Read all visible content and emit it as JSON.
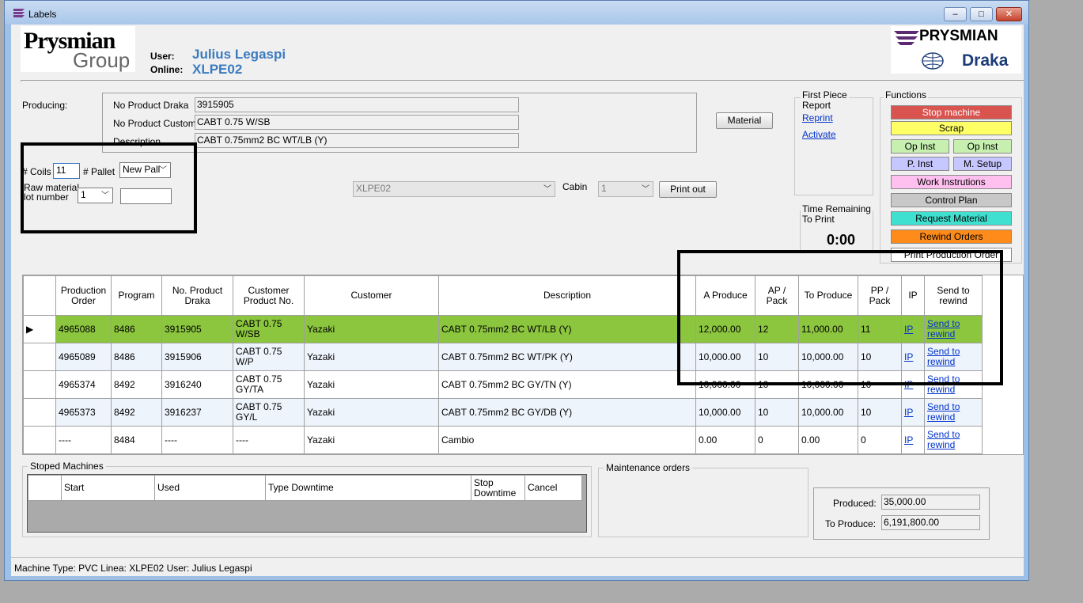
{
  "window": {
    "title": "Labels",
    "min": "–",
    "max": "□",
    "close": "✕"
  },
  "header": {
    "logo_line1": "Prysmian",
    "logo_line2": "Group",
    "user_label": "User:",
    "user_value": "Julius Legaspi",
    "online_label": "Online:",
    "online_value": "XLPE02",
    "brand_top": "PRYSMIAN",
    "brand_bottom": "Draka"
  },
  "producing": {
    "label": "Producing:",
    "no_product_draka_label": "No Product Draka",
    "no_product_draka": "3915905",
    "no_product_customer_label": "No Product Customer",
    "no_product_customer": "CABT 0.75 W/SB",
    "description_label": "Description",
    "description": "CABT 0.75mm2 BC WT/LB (Y)",
    "material_button": "Material"
  },
  "coils": {
    "coils_label": "# Coils",
    "coils_value": "11",
    "pallet_label": "# Pallet",
    "pallet_value": "New Pall",
    "raw_material_label1": "Raw material",
    "raw_material_label2": "lot number",
    "lot_value": "1",
    "lot_text": ""
  },
  "print": {
    "printer_value": "XLPE02",
    "cabin_label": "Cabin",
    "cabin_value": "1",
    "print_button": "Print out"
  },
  "first_piece": {
    "title1": "First Piece",
    "title2": "Report",
    "reprint": "Reprint",
    "activate": "Activate"
  },
  "time_remaining": {
    "title1": "Time Remaining",
    "title2": "To Print",
    "value": "0:00"
  },
  "functions": {
    "title": "Functions",
    "stop_machine": "Stop machine",
    "scrap": "Scrap",
    "op_inst_1": "Op Inst",
    "op_inst_2": "Op Inst",
    "p_inst": "P. Inst",
    "m_setup": "M. Setup",
    "work_instructions": "Work Instrutions",
    "control_plan": "Control Plan",
    "request_material": "Request Material",
    "rewind_orders": "Rewind Orders",
    "print_production_order": "Print Production Order",
    "colors": {
      "stop": "#d9534f",
      "scrap": "#ffff66",
      "op": "#c6efb0",
      "pinst": "#c7c7ff",
      "work": "#ffc0f0",
      "control": "#c8c8c8",
      "request": "#40e0d0",
      "rewind": "#ff8c1a"
    }
  },
  "orders": {
    "headers": {
      "production_order": "Production Order",
      "program": "Program",
      "no_product_draka": "No. Product Draka",
      "customer_product_no": "Customer Product No.",
      "customer": "Customer",
      "description": "Description",
      "a_produce": "A Produce",
      "ap_pack": "AP / Pack",
      "to_produce": "To Produce",
      "pp_pack": "PP / Pack",
      "ip": "IP",
      "send_to_rewind": "Send to rewind"
    },
    "rows": [
      {
        "order": "4965088",
        "program": "8486",
        "draka": "3915905",
        "cust_no": "CABT 0.75 W/SB",
        "customer": "Yazaki",
        "description": "CABT 0.75mm2 BC WT/LB (Y)",
        "a_produce": "12,000.00",
        "ap_pack": "12",
        "to_produce": "11,000.00",
        "pp_pack": "11",
        "ip": "IP",
        "rewind": "Send to rewind"
      },
      {
        "order": "4965089",
        "program": "8486",
        "draka": "3915906",
        "cust_no": "CABT 0.75 W/P",
        "customer": "Yazaki",
        "description": "CABT 0.75mm2 BC WT/PK (Y)",
        "a_produce": "10,000.00",
        "ap_pack": "10",
        "to_produce": "10,000.00",
        "pp_pack": "10",
        "ip": "IP",
        "rewind": "Send to rewind"
      },
      {
        "order": "4965374",
        "program": "8492",
        "draka": "3916240",
        "cust_no": "CABT 0.75 GY/TA",
        "customer": "Yazaki",
        "description": "CABT 0.75mm2 BC GY/TN (Y)",
        "a_produce": "10,000.00",
        "ap_pack": "10",
        "to_produce": "10,000.00",
        "pp_pack": "10",
        "ip": "IP",
        "rewind": "Send to rewind"
      },
      {
        "order": "4965373",
        "program": "8492",
        "draka": "3916237",
        "cust_no": "CABT 0.75 GY/L",
        "customer": "Yazaki",
        "description": "CABT 0.75mm2 BC GY/DB (Y)",
        "a_produce": "10,000.00",
        "ap_pack": "10",
        "to_produce": "10,000.00",
        "pp_pack": "10",
        "ip": "IP",
        "rewind": "Send to rewind"
      },
      {
        "order": "----",
        "program": "8484",
        "draka": "----",
        "cust_no": "----",
        "customer": "Yazaki",
        "description": "Cambio",
        "a_produce": "0.00",
        "ap_pack": "0",
        "to_produce": "0.00",
        "pp_pack": "0",
        "ip": "IP",
        "rewind": "Send to rewind"
      }
    ]
  },
  "stoped": {
    "title": "Stoped Machines",
    "start": "Start",
    "used": "Used",
    "type_downtime": "Type Downtime",
    "stop_downtime": "Stop Downtime",
    "cancel": "Cancel"
  },
  "maintenance": {
    "title": "Maintenance orders"
  },
  "totals": {
    "produced_label": "Produced:",
    "produced": "35,000.00",
    "to_produce_label": "To Produce:",
    "to_produce": "6,191,800.00"
  },
  "status": "Machine Type: PVC  Linea: XLPE02  User: Julius Legaspi"
}
